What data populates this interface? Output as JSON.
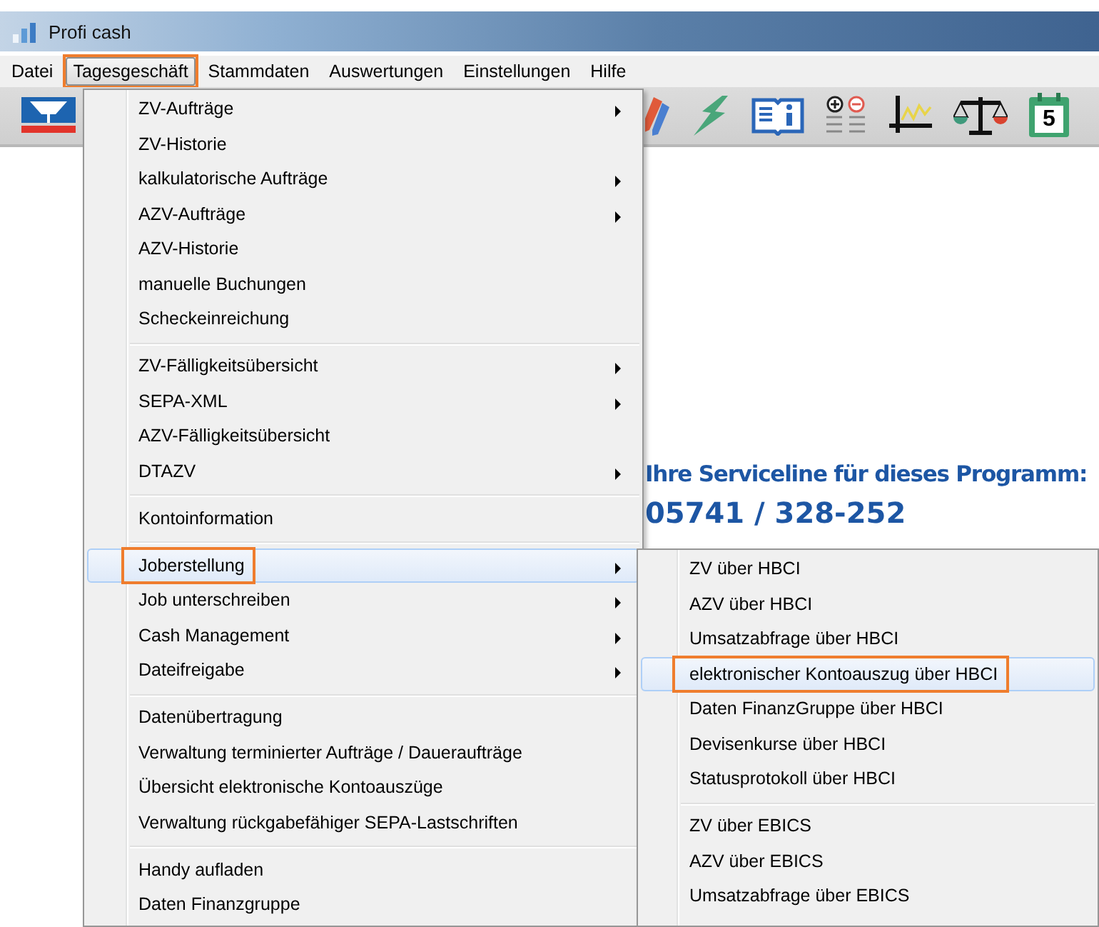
{
  "window": {
    "title": "Profi cash"
  },
  "menubar": [
    {
      "label": "Datei",
      "selected": false,
      "annotated": false
    },
    {
      "label": "Tagesgeschäft",
      "selected": true,
      "annotated": true
    },
    {
      "label": "Stammdaten",
      "selected": false,
      "annotated": false
    },
    {
      "label": "Auswertungen",
      "selected": false,
      "annotated": false
    },
    {
      "label": "Einstellungen",
      "selected": false,
      "annotated": false
    },
    {
      "label": "Hilfe",
      "selected": false,
      "annotated": false
    }
  ],
  "toolbar": {
    "calendar_day": "5"
  },
  "content": {
    "service_heading": "Ihre Serviceline für dieses Programm:",
    "service_phone": "05741 / 328-252"
  },
  "menu": {
    "groups": [
      {
        "items": [
          {
            "label": "ZV-Aufträge",
            "has_submenu": true,
            "highlighted": false,
            "annotated": false
          },
          {
            "label": "ZV-Historie",
            "has_submenu": false,
            "highlighted": false,
            "annotated": false
          },
          {
            "label": "kalkulatorische Aufträge",
            "has_submenu": true,
            "highlighted": false,
            "annotated": false
          },
          {
            "label": "AZV-Aufträge",
            "has_submenu": true,
            "highlighted": false,
            "annotated": false
          },
          {
            "label": "AZV-Historie",
            "has_submenu": false,
            "highlighted": false,
            "annotated": false
          },
          {
            "label": "manuelle Buchungen",
            "has_submenu": false,
            "highlighted": false,
            "annotated": false
          },
          {
            "label": "Scheckeinreichung",
            "has_submenu": false,
            "highlighted": false,
            "annotated": false
          }
        ]
      },
      {
        "items": [
          {
            "label": "ZV-Fälligkeitsübersicht",
            "has_submenu": true,
            "highlighted": false,
            "annotated": false
          },
          {
            "label": "SEPA-XML",
            "has_submenu": true,
            "highlighted": false,
            "annotated": false
          },
          {
            "label": "AZV-Fälligkeitsübersicht",
            "has_submenu": false,
            "highlighted": false,
            "annotated": false
          },
          {
            "label": "DTAZV",
            "has_submenu": true,
            "highlighted": false,
            "annotated": false
          }
        ]
      },
      {
        "items": [
          {
            "label": "Kontoinformation",
            "has_submenu": false,
            "highlighted": false,
            "annotated": false
          }
        ]
      },
      {
        "items": [
          {
            "label": "Joberstellung",
            "has_submenu": true,
            "highlighted": true,
            "annotated": true
          },
          {
            "label": "Job unterschreiben",
            "has_submenu": true,
            "highlighted": false,
            "annotated": false
          },
          {
            "label": "Cash Management",
            "has_submenu": true,
            "highlighted": false,
            "annotated": false
          },
          {
            "label": "Dateifreigabe",
            "has_submenu": true,
            "highlighted": false,
            "annotated": false
          }
        ]
      },
      {
        "items": [
          {
            "label": "Datenübertragung",
            "has_submenu": false,
            "highlighted": false,
            "annotated": false
          },
          {
            "label": "Verwaltung terminierter Aufträge / Daueraufträge",
            "has_submenu": false,
            "highlighted": false,
            "annotated": false
          },
          {
            "label": "Übersicht elektronische Kontoauszüge",
            "has_submenu": false,
            "highlighted": false,
            "annotated": false
          },
          {
            "label": "Verwaltung rückgabefähiger SEPA-Lastschriften",
            "has_submenu": false,
            "highlighted": false,
            "annotated": false
          }
        ]
      },
      {
        "items": [
          {
            "label": "Handy aufladen",
            "has_submenu": false,
            "highlighted": false,
            "annotated": false
          },
          {
            "label": "Daten Finanzgruppe",
            "has_submenu": false,
            "highlighted": false,
            "annotated": false
          }
        ]
      }
    ]
  },
  "submenu": {
    "groups": [
      {
        "items": [
          {
            "label": "ZV über HBCI",
            "has_submenu": false,
            "highlighted": false,
            "annotated": false
          },
          {
            "label": "AZV über HBCI",
            "has_submenu": false,
            "highlighted": false,
            "annotated": false
          },
          {
            "label": "Umsatzabfrage über HBCI",
            "has_submenu": false,
            "highlighted": false,
            "annotated": false
          },
          {
            "label": "elektronischer Kontoauszug über HBCI",
            "has_submenu": false,
            "highlighted": true,
            "annotated": true
          },
          {
            "label": "Daten FinanzGruppe über HBCI",
            "has_submenu": false,
            "highlighted": false,
            "annotated": false
          },
          {
            "label": "Devisenkurse über HBCI",
            "has_submenu": false,
            "highlighted": false,
            "annotated": false
          },
          {
            "label": "Statusprotokoll über HBCI",
            "has_submenu": false,
            "highlighted": false,
            "annotated": false
          }
        ]
      },
      {
        "items": [
          {
            "label": "ZV über EBICS",
            "has_submenu": false,
            "highlighted": false,
            "annotated": false
          },
          {
            "label": "AZV über EBICS",
            "has_submenu": false,
            "highlighted": false,
            "annotated": false
          },
          {
            "label": "Umsatzabfrage über EBICS",
            "has_submenu": false,
            "highlighted": false,
            "annotated": false
          }
        ]
      }
    ]
  }
}
